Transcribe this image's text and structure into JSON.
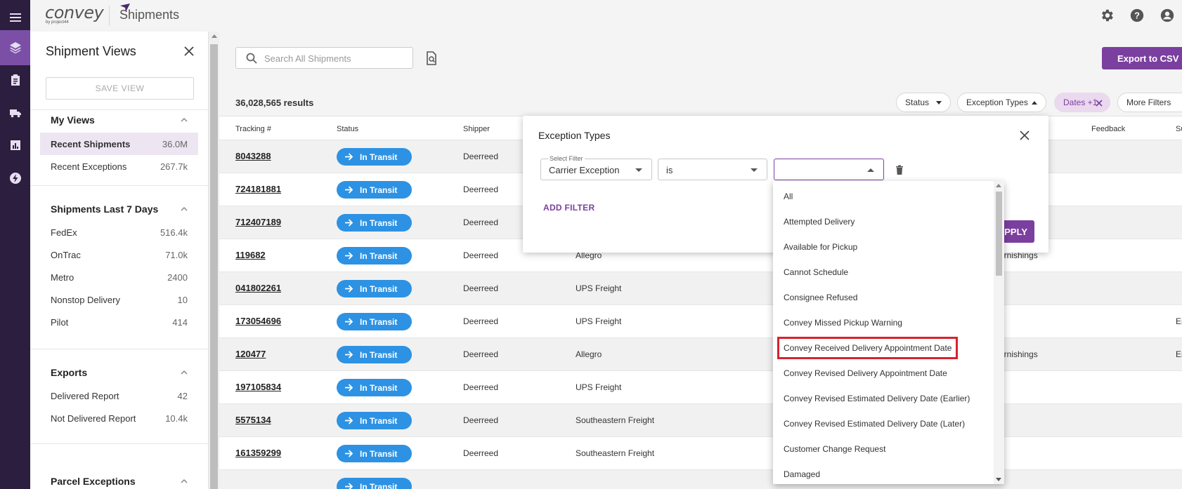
{
  "app": {
    "logo": "convey",
    "logo_sub": "by project44",
    "page_title": "Shipments"
  },
  "colors": {
    "rail": "#2c1e3e",
    "accent": "#7b3fa0",
    "status_pill": "#2d92e3",
    "highlight_box": "#d7232e"
  },
  "rail_icons": [
    "menu-icon",
    "layers-icon",
    "clipboard-icon",
    "truck-icon",
    "bar-chart-icon",
    "bolt-icon"
  ],
  "sidebar": {
    "title": "Shipment Views",
    "save_view_label": "SAVE VIEW",
    "sections": [
      {
        "title": "My Views",
        "items": [
          {
            "label": "Recent Shipments",
            "count": "36.0M",
            "selected": true
          },
          {
            "label": "Recent Exceptions",
            "count": "267.7k"
          }
        ]
      },
      {
        "title": "Shipments Last 7 Days",
        "items": [
          {
            "label": "FedEx",
            "count": "516.4k"
          },
          {
            "label": "OnTrac",
            "count": "71.0k"
          },
          {
            "label": "Metro",
            "count": "2400"
          },
          {
            "label": "Nonstop Delivery",
            "count": "10"
          },
          {
            "label": "Pilot",
            "count": "414"
          }
        ]
      },
      {
        "title": "Exports",
        "items": [
          {
            "label": "Delivered Report",
            "count": "42"
          },
          {
            "label": "Not Delivered Report",
            "count": "10.4k"
          }
        ]
      },
      {
        "title": "Parcel Exceptions",
        "items": []
      }
    ]
  },
  "main": {
    "search_placeholder": "Search All Shipments",
    "export_label": "Export to CSV",
    "results": "36,028,565 results",
    "filters": {
      "status": "Status",
      "exception_types": "Exception Types",
      "dates": "Dates +1",
      "more": "More Filters"
    },
    "columns": [
      "Tracking #",
      "Status",
      "Shipper",
      "Feedback",
      "Su"
    ],
    "rows": [
      {
        "tracking": "8043288",
        "status": "In Transit",
        "shipper": "Deerreed",
        "carrier": "",
        "extra": "",
        "right": ""
      },
      {
        "tracking": "724181881",
        "status": "In Transit",
        "shipper": "Deerreed",
        "carrier": "",
        "extra": "",
        "right": ""
      },
      {
        "tracking": "712407189",
        "status": "In Transit",
        "shipper": "Deerreed",
        "carrier": "",
        "extra": "",
        "right": ""
      },
      {
        "tracking": "119682",
        "status": "In Transit",
        "shipper": "Deerreed",
        "carrier": "Allegro",
        "extra": "urnishings",
        "right": ""
      },
      {
        "tracking": "041802261",
        "status": "In Transit",
        "shipper": "Deerreed",
        "carrier": "UPS Freight",
        "extra": "",
        "right": ""
      },
      {
        "tracking": "173054696",
        "status": "In Transit",
        "shipper": "Deerreed",
        "carrier": "UPS Freight",
        "extra": "",
        "right": "Er"
      },
      {
        "tracking": "120477",
        "status": "In Transit",
        "shipper": "Deerreed",
        "carrier": "Allegro",
        "extra": "urnishings",
        "right": "Er"
      },
      {
        "tracking": "197105834",
        "status": "In Transit",
        "shipper": "Deerreed",
        "carrier": "UPS Freight",
        "extra": "",
        "right": ""
      },
      {
        "tracking": "5575134",
        "status": "In Transit",
        "shipper": "Deerreed",
        "carrier": "Southeastern Freight",
        "extra": "",
        "right": ""
      },
      {
        "tracking": "161359299",
        "status": "In Transit",
        "shipper": "Deerreed",
        "carrier": "Southeastern Freight",
        "extra": "",
        "right": ""
      },
      {
        "tracking": "",
        "status": "In Transit",
        "shipper": "",
        "carrier": "",
        "extra": "",
        "right": ""
      }
    ]
  },
  "popover": {
    "title": "Exception Types",
    "select_filter_label": "Select Filter",
    "select_filter_value": "Carrier Exception",
    "operator_value": "is",
    "value_value": "",
    "add_filter_label": "ADD FILTER",
    "apply_label": "APPLY",
    "options": [
      "All",
      "Attempted Delivery",
      "Available for Pickup",
      "Cannot Schedule",
      "Consignee Refused",
      "Convey Missed Pickup Warning",
      "Convey Received Delivery Appointment Date",
      "Convey Revised Delivery Appointment Date",
      "Convey Revised Estimated Delivery Date (Earlier)",
      "Convey Revised Estimated Delivery Date (Later)",
      "Customer Change Request",
      "Damaged"
    ],
    "highlighted_option": "Convey Received Delivery Appointment Date"
  }
}
